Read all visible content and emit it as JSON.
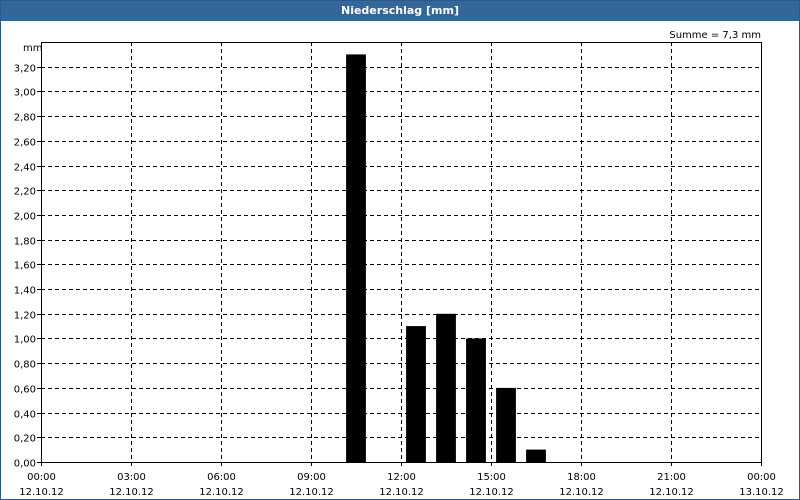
{
  "window": {
    "title": "Niederschlag [mm]"
  },
  "chart_data": {
    "type": "bar",
    "unit_label": "mm",
    "sum_label": "Summe = 7,3 mm",
    "ylim": [
      0,
      3.4
    ],
    "y_ticks": [
      {
        "value": 0.0,
        "label": "0,00"
      },
      {
        "value": 0.2,
        "label": "0,20"
      },
      {
        "value": 0.4,
        "label": "0,40"
      },
      {
        "value": 0.6,
        "label": "0,60"
      },
      {
        "value": 0.8,
        "label": "0,80"
      },
      {
        "value": 1.0,
        "label": "1,00"
      },
      {
        "value": 1.2,
        "label": "1,20"
      },
      {
        "value": 1.4,
        "label": "1,40"
      },
      {
        "value": 1.6,
        "label": "1,60"
      },
      {
        "value": 1.8,
        "label": "1,80"
      },
      {
        "value": 2.0,
        "label": "2,00"
      },
      {
        "value": 2.2,
        "label": "2,20"
      },
      {
        "value": 2.4,
        "label": "2,40"
      },
      {
        "value": 2.6,
        "label": "2,60"
      },
      {
        "value": 2.8,
        "label": "2,80"
      },
      {
        "value": 3.0,
        "label": "3,00"
      },
      {
        "value": 3.2,
        "label": "3,20"
      }
    ],
    "xlim": [
      "12.10.12 00:00",
      "13.10.12 00:00"
    ],
    "x_ticks": [
      {
        "time": "00:00",
        "date": "12.10.12"
      },
      {
        "time": "03:00",
        "date": "12.10.12"
      },
      {
        "time": "06:00",
        "date": "12.10.12"
      },
      {
        "time": "09:00",
        "date": "12.10.12"
      },
      {
        "time": "12:00",
        "date": "12.10.12"
      },
      {
        "time": "15:00",
        "date": "12.10.12"
      },
      {
        "time": "18:00",
        "date": "12.10.12"
      },
      {
        "time": "21:00",
        "date": "12.10.12"
      },
      {
        "time": "00:00",
        "date": "13.10.12"
      }
    ],
    "bars": [
      {
        "time": "12.10.12 10:00",
        "value": 3.3
      },
      {
        "time": "12.10.12 12:00",
        "value": 1.1
      },
      {
        "time": "12.10.12 13:00",
        "value": 1.2
      },
      {
        "time": "12.10.12 14:00",
        "value": 1.0
      },
      {
        "time": "12.10.12 15:00",
        "value": 0.6
      },
      {
        "time": "12.10.12 16:00",
        "value": 0.1
      }
    ],
    "grid": true,
    "bar_color": "#000000"
  }
}
